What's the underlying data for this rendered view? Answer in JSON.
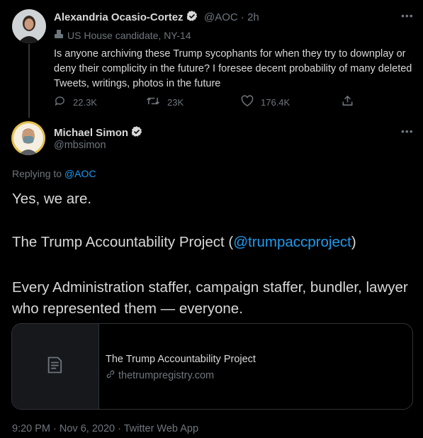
{
  "original_tweet": {
    "author_name": "Alexandria Ocasio-Cortez",
    "handle_time": "@AOC · 2h",
    "label": "US House candidate, NY-14",
    "text": "Is anyone archiving these Trump sycophants for when they try to downplay or deny their complicity in the future? I foresee decent probability of many deleted Tweets, writings, photos in the future",
    "replies": "22.3K",
    "retweets": "23K",
    "likes": "176.4K"
  },
  "reply_tweet": {
    "author_name": "Michael Simon",
    "handle": "@mbsimon",
    "replying_prefix": "Replying to ",
    "replying_to": "@AOC",
    "line1": "Yes, we are.",
    "line2_prefix": "The Trump Accountability Project (",
    "line2_mention": "@trumpaccproject",
    "line2_suffix": ")",
    "line3": "Every Administration staffer, campaign staffer, bundler, lawyer who represented them — everyone.",
    "card_title": "The Trump Accountability Project",
    "card_domain": "thetrumpregistry.com",
    "timestamp": "9:20 PM · Nov 6, 2020 · Twitter Web App"
  },
  "colors": {
    "background": "#000000",
    "text": "#d9d9d9",
    "muted": "#6e767d",
    "link": "#1d9bf0",
    "border": "#2f3336"
  },
  "icons": [
    "verified-icon",
    "more-icon",
    "ballot-box-icon",
    "reply-icon",
    "retweet-icon",
    "like-icon",
    "share-icon",
    "article-icon",
    "link-icon"
  ]
}
